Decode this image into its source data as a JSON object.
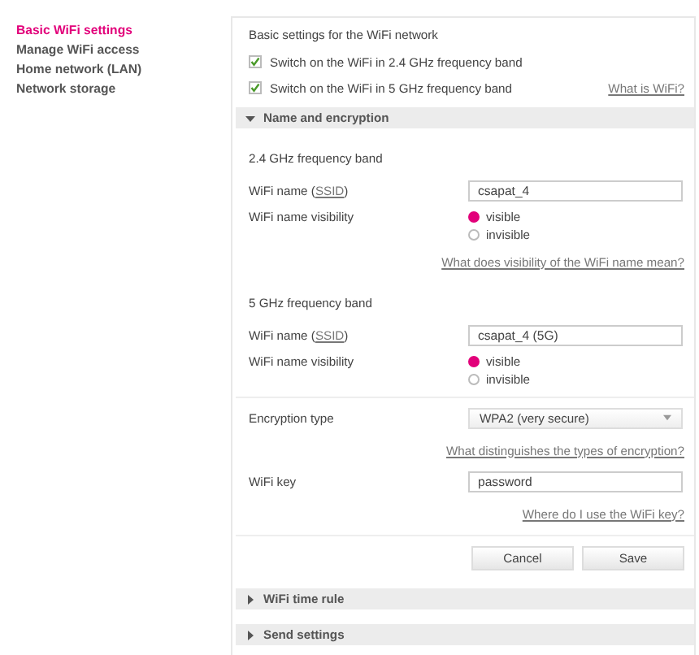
{
  "sidebar": {
    "items": [
      {
        "label": "Basic WiFi settings",
        "selected": true
      },
      {
        "label": "Manage WiFi access",
        "selected": false
      },
      {
        "label": "Home network (LAN)",
        "selected": false
      },
      {
        "label": "Network storage",
        "selected": false
      }
    ]
  },
  "basic": {
    "title": "Basic settings for the WiFi network",
    "checkboxes": [
      {
        "label": "Switch on the WiFi in 2.4 GHz frequency band",
        "checked": true
      },
      {
        "label": "Switch on the WiFi in 5 GHz frequency band",
        "checked": true
      }
    ],
    "help_link": "What is WiFi?"
  },
  "name_encryption": {
    "title": "Name and encryption",
    "expanded": true,
    "bands": [
      {
        "heading": "2.4 GHz frequency band",
        "name_label": "WiFi name (",
        "ssid_link": "SSID",
        "name_label_end": ")",
        "name_value": "csapat_4",
        "visibility_label": "WiFi name visibility",
        "options": [
          {
            "label": "visible",
            "selected": true
          },
          {
            "label": "invisible",
            "selected": false
          }
        ],
        "help_link": "What does visibility of the WiFi name mean?"
      },
      {
        "heading": "5 GHz frequency band",
        "name_label": "WiFi name (",
        "ssid_link": "SSID",
        "name_label_end": ")",
        "name_value": "csapat_4 (5G)",
        "visibility_label": "WiFi name visibility",
        "options": [
          {
            "label": "visible",
            "selected": true
          },
          {
            "label": "invisible",
            "selected": false
          }
        ]
      }
    ],
    "encryption_label": "Encryption type",
    "encryption_value": "WPA2 (very secure)",
    "encryption_link": "What distinguishes the types of encryption?",
    "key_label": "WiFi key",
    "key_value": "password",
    "key_link": "Where do I use the WiFi key?",
    "buttons": [
      "Cancel",
      "Save"
    ]
  },
  "collapsed_sections": [
    {
      "title": "WiFi time rule",
      "expanded": false
    },
    {
      "title": "Send settings",
      "expanded": false
    }
  ]
}
